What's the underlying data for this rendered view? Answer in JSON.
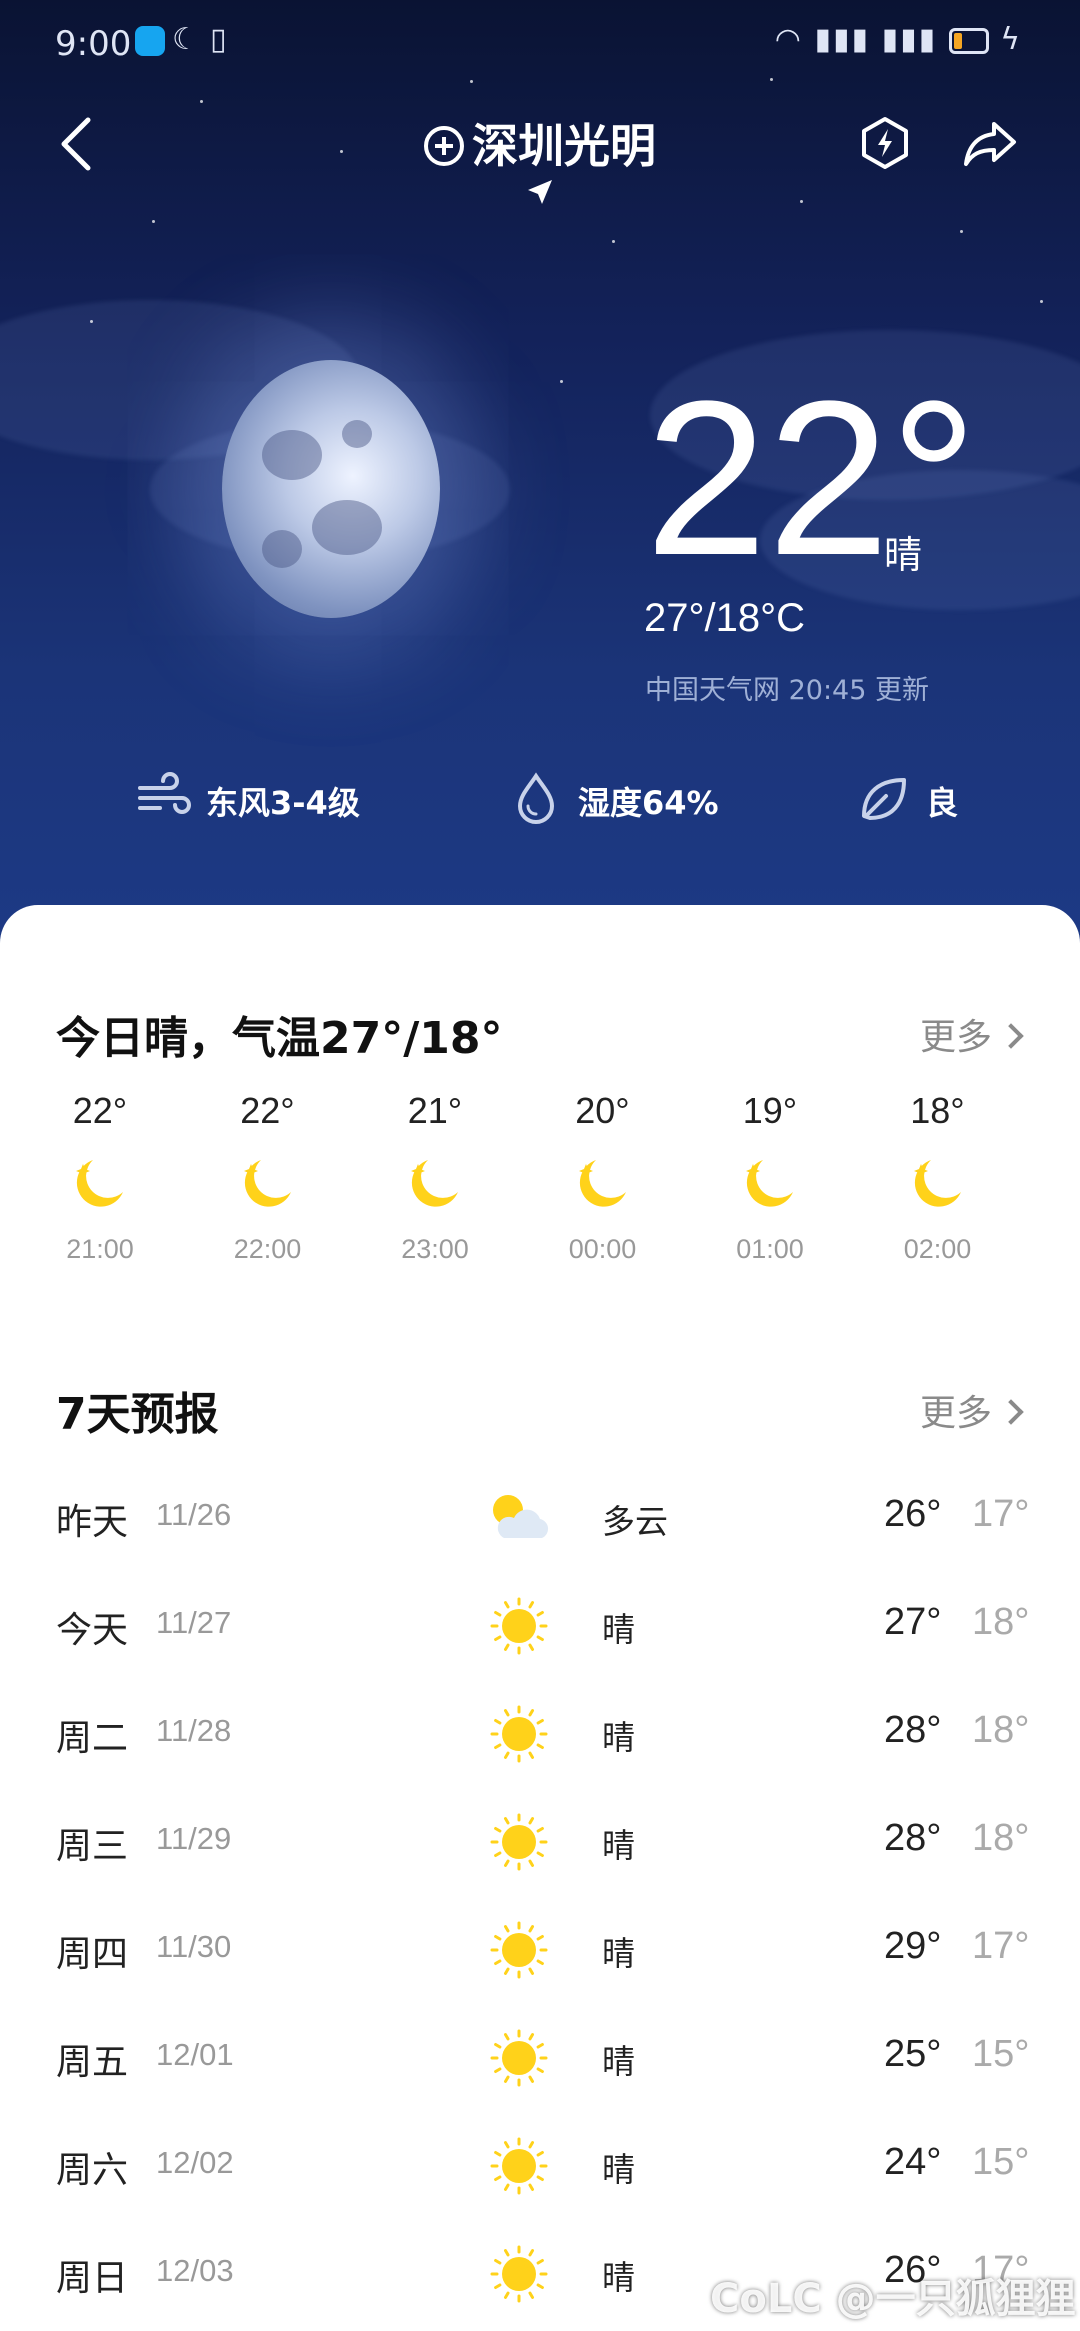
{
  "status_bar": {
    "time": "9:00"
  },
  "header": {
    "city": "深圳光明"
  },
  "current": {
    "temperature": "22°",
    "condition": "晴",
    "range": "27°/18°C",
    "source": "中国天气网 20:45 更新",
    "wind": "东风3-4级",
    "humidity": "湿度64%",
    "air_quality": "良"
  },
  "today": {
    "title": "今日晴，气温27°/18°",
    "more_label": "更多",
    "hourly": [
      {
        "temp": "22°",
        "time": "21:00",
        "icon": "moon-icon"
      },
      {
        "temp": "22°",
        "time": "22:00",
        "icon": "moon-icon"
      },
      {
        "temp": "21°",
        "time": "23:00",
        "icon": "moon-icon"
      },
      {
        "temp": "20°",
        "time": "00:00",
        "icon": "moon-icon"
      },
      {
        "temp": "19°",
        "time": "01:00",
        "icon": "moon-icon"
      },
      {
        "temp": "18°",
        "time": "02:00",
        "icon": "moon-icon"
      }
    ]
  },
  "forecast": {
    "title": "7天预报",
    "more_label": "更多",
    "days": [
      {
        "name": "昨天",
        "date": "11/26",
        "icon": "partly-cloudy-icon",
        "condition": "多云",
        "high": "26°",
        "low": "17°"
      },
      {
        "name": "今天",
        "date": "11/27",
        "icon": "sun-icon",
        "condition": "晴",
        "high": "27°",
        "low": "18°"
      },
      {
        "name": "周二",
        "date": "11/28",
        "icon": "sun-icon",
        "condition": "晴",
        "high": "28°",
        "low": "18°"
      },
      {
        "name": "周三",
        "date": "11/29",
        "icon": "sun-icon",
        "condition": "晴",
        "high": "28°",
        "low": "18°"
      },
      {
        "name": "周四",
        "date": "11/30",
        "icon": "sun-icon",
        "condition": "晴",
        "high": "29°",
        "low": "17°"
      },
      {
        "name": "周五",
        "date": "12/01",
        "icon": "sun-icon",
        "condition": "晴",
        "high": "25°",
        "low": "15°"
      },
      {
        "name": "周六",
        "date": "12/02",
        "icon": "sun-icon",
        "condition": "晴",
        "high": "24°",
        "low": "15°"
      },
      {
        "name": "周日",
        "date": "12/03",
        "icon": "sun-icon",
        "condition": "晴",
        "high": "26°",
        "low": "17°"
      }
    ]
  },
  "watermark": "CoLC @一只狐狸狸",
  "colors": {
    "sun": "#ffd21a",
    "sky_top": "#0a1333",
    "sky_bottom": "#1d3a86"
  }
}
